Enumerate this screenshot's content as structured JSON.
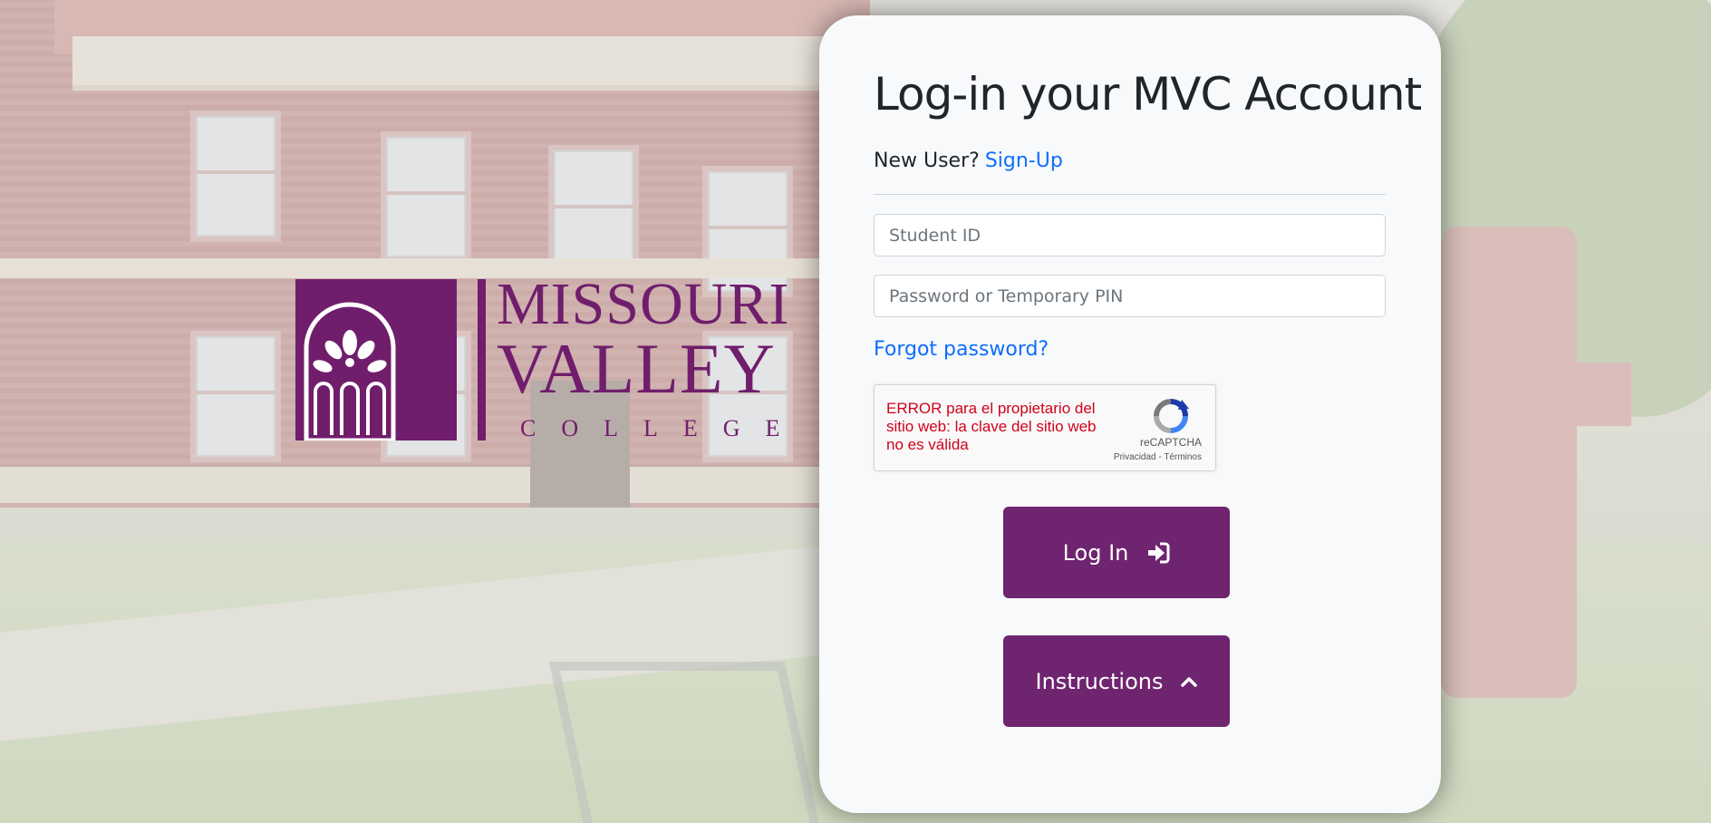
{
  "logo": {
    "line1": "MISSOURI",
    "line2": "VALLEY",
    "line3": "COLLEGE",
    "color": "#701e6c"
  },
  "login_card": {
    "title": "Log-in your MVC Account",
    "new_user_prompt": "New User?",
    "signup_link": "Sign-Up",
    "student_id_placeholder": "Student ID",
    "password_placeholder": "Password or Temporary PIN",
    "forgot_password_link": "Forgot password?",
    "login_button": "Log In",
    "login_icon": "sign-in-icon",
    "instructions_button": "Instructions",
    "instructions_icon": "chevron-up-icon",
    "accent_color": "#6f2470",
    "link_color": "#0d6efd"
  },
  "recaptcha": {
    "error": "ERROR para el propietario del sitio web: la clave del sitio web no es válida",
    "brand": "reCAPTCHA",
    "links": "Privacidad - Términos",
    "error_color": "#d0021b"
  }
}
